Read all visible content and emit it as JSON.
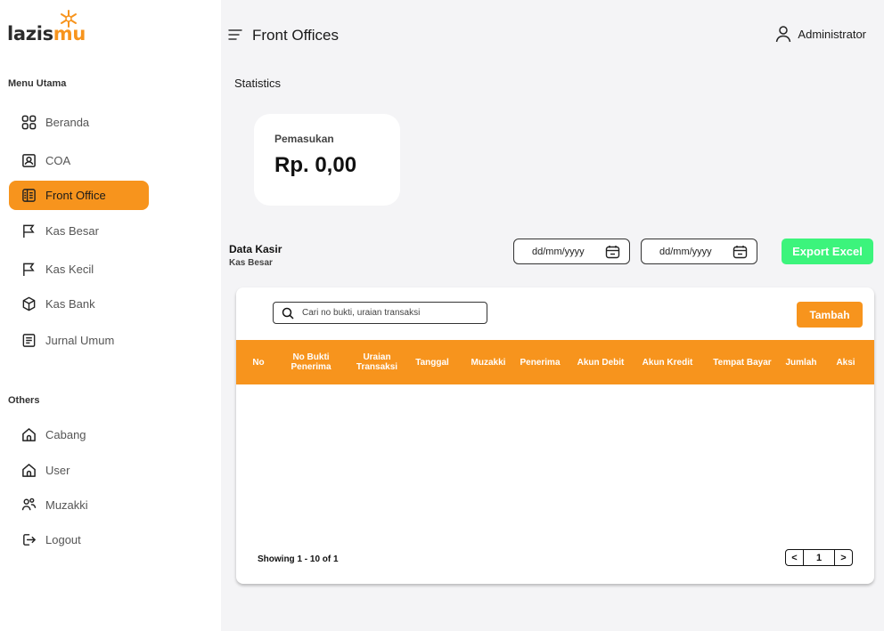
{
  "brand": {
    "name_prefix": "lazis",
    "name_suffix": "mu",
    "accent": "#f7941d"
  },
  "sidebar": {
    "section_main": "Menu Utama",
    "main_items": [
      {
        "label": "Beranda",
        "icon": "grid-icon"
      },
      {
        "label": "COA",
        "icon": "id-card-icon"
      },
      {
        "label": "Front Office",
        "icon": "building-icon",
        "active": true
      },
      {
        "label": "Kas Besar",
        "icon": "flag-icon"
      },
      {
        "label": "Kas Kecil",
        "icon": "flag-icon"
      },
      {
        "label": "Kas Bank",
        "icon": "cube-icon"
      },
      {
        "label": "Jurnal Umum",
        "icon": "document-icon"
      }
    ],
    "section_others": "Others",
    "other_items": [
      {
        "label": "Cabang",
        "icon": "home-icon"
      },
      {
        "label": "User",
        "icon": "home-icon"
      },
      {
        "label": "Muzakki",
        "icon": "users-icon"
      },
      {
        "label": "Logout",
        "icon": "logout-icon"
      }
    ]
  },
  "header": {
    "title": "Front Offices",
    "user": "Administrator"
  },
  "stats": {
    "label": "Statistics",
    "card_label": "Pemasukan",
    "card_value": "Rp. 0,00"
  },
  "data_section": {
    "title": "Data Kasir",
    "subtitle": "Kas Besar",
    "date_from_placeholder": "dd/mm/yyyy",
    "date_to_placeholder": "dd/mm/yyyy",
    "export_label": "Export Excel",
    "export_color": "#3cf47c"
  },
  "table": {
    "search_placeholder": "Cari no bukti, uraian transaksi",
    "add_label": "Tambah",
    "columns": [
      "No",
      "No Bukti\nPenerima",
      "Uraian\nTransaksi",
      "Tanggal",
      "Muzakki",
      "Penerima",
      "Akun Debit",
      "Akun Kredit",
      "Tempat Bayar",
      "Jumlah",
      "Aksi"
    ],
    "rows": [],
    "showing": "Showing 1 - 10 of 1",
    "pagination": {
      "prev": "<",
      "page": "1",
      "next": ">"
    }
  }
}
